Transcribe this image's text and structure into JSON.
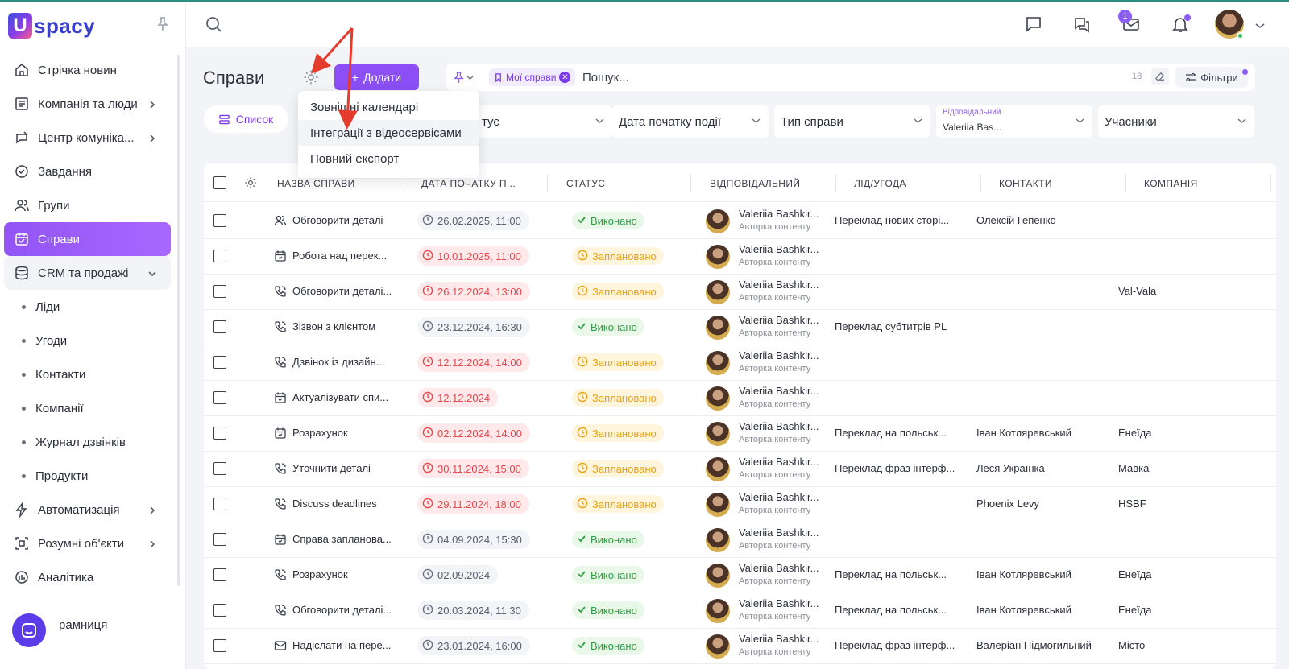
{
  "brand": {
    "logo_letter": "U",
    "logo_text": "spacy"
  },
  "sidebar": {
    "items": [
      {
        "label": "Стрічка новин",
        "icon": "home-icon",
        "chevron": false
      },
      {
        "label": "Компанія та люди",
        "icon": "org-chart-icon",
        "chevron": true
      },
      {
        "label": "Центр комуніка...",
        "icon": "communication-icon",
        "chevron": true
      },
      {
        "label": "Завдання",
        "icon": "check-circle-icon",
        "chevron": false
      },
      {
        "label": "Групи",
        "icon": "group-icon",
        "chevron": false
      },
      {
        "label": "Справи",
        "icon": "calendar-check-icon",
        "chevron": false,
        "active": true
      },
      {
        "label": "CRM та продажі",
        "icon": "database-icon",
        "chevron": true,
        "expanded": true
      }
    ],
    "crm_sub": [
      "Ліди",
      "Угоди",
      "Контакти",
      "Компанії",
      "Журнал дзвінків",
      "Продукти"
    ],
    "items_after": [
      {
        "label": "Автоматизація",
        "icon": "lightning-icon"
      },
      {
        "label": "Розумні об'єкти",
        "icon": "smart-object-icon"
      },
      {
        "label": "Аналітика",
        "icon": "analytics-icon"
      }
    ],
    "last_item": "рамниця"
  },
  "topbar": {
    "mail_badge": "1"
  },
  "page": {
    "title": "Справи",
    "add_label": "Додати"
  },
  "search": {
    "chip": "Мої справи",
    "placeholder": "Пошук...",
    "count": "18",
    "filters_label": "Фільтри"
  },
  "view": {
    "list_label": "Список"
  },
  "filters": {
    "status": "тус",
    "start_date": "Дата початку події",
    "type": "Тип справи",
    "responsible_label": "Відповідальний",
    "responsible_value": "Valeriia Bas...",
    "participants": "Учасники"
  },
  "menu": {
    "items": [
      "Зовнішні календарі",
      "Інтеграції з відеосервісами",
      "Повний експорт"
    ],
    "hover_index": 1
  },
  "table": {
    "headers": [
      "НАЗВА СПРАВИ",
      "ДАТА ПОЧАТКУ П...",
      "СТАТУС",
      "ВІДПОВІДАЛЬНИЙ",
      "ЛІД/УГОДА",
      "КОНТАКТИ",
      "КОМПАНІЯ"
    ],
    "responsible_name": "Valeriia Bashkir...",
    "responsible_role": "Авторка контенту",
    "rows": [
      {
        "icon": "people-icon",
        "name": "Обговорити деталі",
        "date": "26.02.2025, 11:00",
        "late": false,
        "status": "Виконано",
        "done": true,
        "lead": "Переклад нових сторі...",
        "contact": "Олексій Гепенко",
        "company": ""
      },
      {
        "icon": "calendar-icon",
        "name": "Робота над перек...",
        "date": "10.01.2025, 11:00",
        "late": true,
        "status": "Заплановано",
        "done": false,
        "lead": "",
        "contact": "",
        "company": ""
      },
      {
        "icon": "phone-icon",
        "name": "Обговорити деталі...",
        "date": "26.12.2024, 13:00",
        "late": true,
        "status": "Заплановано",
        "done": false,
        "lead": "",
        "contact": "",
        "company": "Val-Vala"
      },
      {
        "icon": "phone-icon",
        "name": "Зізвон з клієнтом",
        "date": "23.12.2024, 16:30",
        "late": false,
        "status": "Виконано",
        "done": true,
        "lead": "Переклад субтитрів PL",
        "contact": "",
        "company": ""
      },
      {
        "icon": "phone-icon",
        "name": "Дзвінок із дизайн...",
        "date": "12.12.2024, 14:00",
        "late": true,
        "status": "Заплановано",
        "done": false,
        "lead": "",
        "contact": "",
        "company": ""
      },
      {
        "icon": "calendar-icon",
        "name": "Актуалізувати спи...",
        "date": "12.12.2024",
        "late": true,
        "status": "Заплановано",
        "done": false,
        "lead": "",
        "contact": "",
        "company": ""
      },
      {
        "icon": "calendar-icon",
        "name": "Розрахунок",
        "date": "02.12.2024, 14:00",
        "late": true,
        "status": "Заплановано",
        "done": false,
        "lead": "Переклад на польськ...",
        "contact": "Іван Котляревський",
        "company": "Енеїда"
      },
      {
        "icon": "phone-icon",
        "name": "Уточнити деталі",
        "date": "30.11.2024, 15:00",
        "late": true,
        "status": "Заплановано",
        "done": false,
        "lead": "Переклад фраз інтерф...",
        "contact": "Леся Українка",
        "company": "Мавка"
      },
      {
        "icon": "phone-icon",
        "name": "Discuss deadlines",
        "date": "29.11.2024, 18:00",
        "late": true,
        "status": "Заплановано",
        "done": false,
        "lead": "",
        "contact": "Phoenix Levy",
        "company": "HSBF"
      },
      {
        "icon": "calendar-icon",
        "name": "Справа запланова...",
        "date": "04.09.2024, 15:30",
        "late": false,
        "status": "Виконано",
        "done": true,
        "lead": "",
        "contact": "",
        "company": ""
      },
      {
        "icon": "phone-icon",
        "name": "Розрахунок",
        "date": "02.09.2024",
        "late": false,
        "status": "Виконано",
        "done": true,
        "lead": "Переклад на польськ...",
        "contact": "Іван Котляревський",
        "company": "Енеїда"
      },
      {
        "icon": "phone-icon",
        "name": "Обговорити деталі...",
        "date": "20.03.2024, 11:30",
        "late": false,
        "status": "Виконано",
        "done": true,
        "lead": "Переклад на польськ...",
        "contact": "Іван Котляревський",
        "company": "Енеїда"
      },
      {
        "icon": "mail-icon",
        "name": "Надіслати на пере...",
        "date": "23.01.2024, 16:00",
        "late": false,
        "status": "Виконано",
        "done": true,
        "lead": "Переклад фраз інтерф...",
        "contact": "Валеріан Підмогильний",
        "company": "Місто"
      }
    ]
  },
  "colors": {
    "accent": "#8b4ff5",
    "late": "#e5484d",
    "done": "#2f9e44",
    "planned": "#e8a317",
    "annotation": "#e53b2c"
  }
}
